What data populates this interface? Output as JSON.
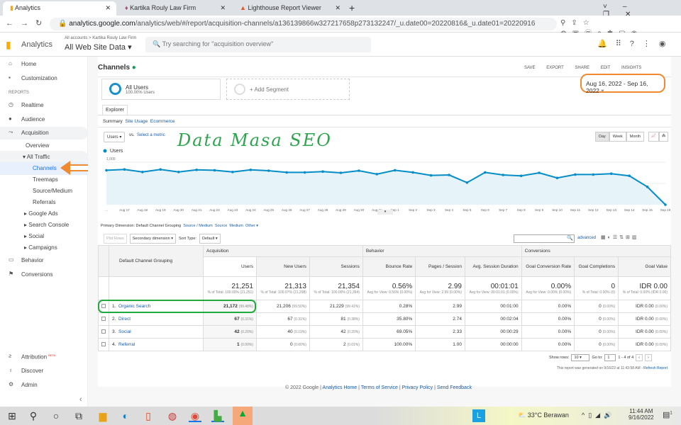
{
  "browser": {
    "tabs": [
      {
        "label": "Analytics",
        "active": true
      },
      {
        "label": "Kartika Rouly Law Firm"
      },
      {
        "label": "Lighthouse Report Viewer"
      }
    ],
    "url_domain": "analytics.google.com",
    "url_path": "/analytics/web/#/report/acquisition-channels/a136139866w327217658p273132247/_u.date00=20220816&_u.date01=20220916"
  },
  "ga": {
    "product": "Analytics",
    "breadcrumb": "All accounts > Kartika Rouly Law Firm",
    "property": "All Web Site Data",
    "search_placeholder": "Try searching for \"acquisition overview\"",
    "notif_count": "2"
  },
  "sidebar": {
    "items": [
      {
        "label": "Home",
        "icon": "home-icon"
      },
      {
        "label": "Customization",
        "icon": "dashboard-icon"
      }
    ],
    "reports_label": "REPORTS",
    "reports": [
      {
        "label": "Realtime",
        "icon": "clock-icon"
      },
      {
        "label": "Audience",
        "icon": "person-icon"
      },
      {
        "label": "Acquisition",
        "icon": "acquisition-icon"
      }
    ],
    "acq_sub": [
      "Overview",
      "All Traffic",
      "Channels",
      "Treemaps",
      "Source/Medium",
      "Referrals",
      "Google Ads",
      "Search Console",
      "Social",
      "Campaigns"
    ],
    "more": [
      {
        "label": "Behavior"
      },
      {
        "label": "Conversions"
      }
    ],
    "bottom": [
      {
        "label": "Attribution",
        "badge": "BETA"
      },
      {
        "label": "Discover"
      },
      {
        "label": "Admin"
      }
    ]
  },
  "report": {
    "title": "Channels",
    "actions": [
      "SAVE",
      "EXPORT",
      "SHARE",
      "EDIT",
      "INSIGHTS"
    ],
    "segment": {
      "name": "All Users",
      "sub": "100.00% Users",
      "add": "+ Add Segment"
    },
    "date_range": "Aug 16, 2022 - Sep 16, 2022",
    "explorer_tab": "Explorer",
    "subtabs": [
      "Summary",
      "Site Usage",
      "Ecommerce"
    ],
    "metric": "Users",
    "vs": "vs.",
    "select_metric": "Select a metric",
    "granularity": [
      "Day",
      "Week",
      "Month"
    ],
    "annotation": "Data Masa SEO",
    "primary_dim_label": "Primary Dimension:",
    "primary_dims": [
      "Default Channel Grouping",
      "Source / Medium",
      "Source",
      "Medium",
      "Other"
    ],
    "plot_rows": "Plot Rows",
    "secondary_dim": "Secondary dimension",
    "sort_type_label": "Sort Type:",
    "sort_type": "Default",
    "advanced": "advanced"
  },
  "chart_data": {
    "type": "area",
    "series": [
      {
        "name": "Users",
        "values": [
          810,
          830,
          770,
          830,
          770,
          820,
          810,
          770,
          820,
          800,
          760,
          760,
          780,
          750,
          800,
          720,
          810,
          760,
          690,
          700,
          520,
          760,
          700,
          680,
          750,
          630,
          710,
          710,
          730,
          680,
          420,
          0
        ]
      }
    ],
    "x": [
      "…",
      "Aug 17",
      "Aug 18",
      "Aug 19",
      "Aug 20",
      "Aug 21",
      "Aug 22",
      "Aug 23",
      "Aug 24",
      "Aug 25",
      "Aug 26",
      "Aug 27",
      "Aug 28",
      "Aug 29",
      "Aug 30",
      "Aug 31",
      "Sep 1",
      "Sep 2",
      "Sep 3",
      "Sep 4",
      "Sep 5",
      "Sep 6",
      "Sep 7",
      "Sep 8",
      "Sep 9",
      "Sep 10",
      "Sep 11",
      "Sep 12",
      "Sep 13",
      "Sep 14",
      "Sep 15",
      "Sep 16"
    ],
    "yticks": [
      "1,000",
      "500"
    ],
    "ylim": [
      0,
      1000
    ],
    "grid": true,
    "color": "#058dc7",
    "fill": "#e6f4fa"
  },
  "table": {
    "dim_header": "Default Channel Grouping",
    "groups": [
      "Acquisition",
      "Behavior",
      "Conversions"
    ],
    "columns": [
      "Users",
      "New Users",
      "Sessions",
      "Bounce Rate",
      "Pages / Session",
      "Avg. Session Duration",
      "Goal Conversion Rate",
      "Goal Completions",
      "Goal Value"
    ],
    "totals": [
      [
        "21,251",
        "% of Total: 100.00% (21,251)"
      ],
      [
        "21,313",
        "% of Total: 100.07% (21,298)"
      ],
      [
        "21,354",
        "% of Total: 100.00% (21,354)"
      ],
      [
        "0.56%",
        "Avg for View: 0.56% (0.00%)"
      ],
      [
        "2.99",
        "Avg for View: 2.99 (0.00%)"
      ],
      [
        "00:01:01",
        "Avg for View: 00:01:01 (0.00%)"
      ],
      [
        "0.00%",
        "Avg for View: 0.00% (0.00%)"
      ],
      [
        "0",
        "% of Total: 0.00% (0)"
      ],
      [
        "IDR 0.00",
        "% of Total: 0.00% (IDR 0.00)"
      ]
    ],
    "rows": [
      {
        "idx": "1.",
        "name": "Organic Search",
        "cells": [
          [
            "21,172",
            "(99.48%)"
          ],
          [
            "21,206",
            "(99.50%)"
          ],
          [
            "21,229",
            "(99.41%)"
          ],
          [
            "0.28%",
            ""
          ],
          [
            "2.99",
            ""
          ],
          [
            "00:01:00",
            ""
          ],
          [
            "0.00%",
            ""
          ],
          [
            "0",
            "(0.00%)"
          ],
          [
            "IDR 0.00",
            "(0.00%)"
          ]
        ]
      },
      {
        "idx": "2.",
        "name": "Direct",
        "cells": [
          [
            "67",
            "(0.31%)"
          ],
          [
            "67",
            "(0.31%)"
          ],
          [
            "81",
            "(0.38%)"
          ],
          [
            "35.80%",
            ""
          ],
          [
            "2.74",
            ""
          ],
          [
            "00:02:04",
            ""
          ],
          [
            "0.00%",
            ""
          ],
          [
            "0",
            "(0.00%)"
          ],
          [
            "IDR 0.00",
            "(0.00%)"
          ]
        ]
      },
      {
        "idx": "3.",
        "name": "Social",
        "cells": [
          [
            "42",
            "(0.20%)"
          ],
          [
            "40",
            "(0.19%)"
          ],
          [
            "42",
            "(0.20%)"
          ],
          [
            "69.05%",
            ""
          ],
          [
            "2.33",
            ""
          ],
          [
            "00:00:29",
            ""
          ],
          [
            "0.00%",
            ""
          ],
          [
            "0",
            "(0.00%)"
          ],
          [
            "IDR 0.00",
            "(0.00%)"
          ]
        ]
      },
      {
        "idx": "4.",
        "name": "Referral",
        "cells": [
          [
            "1",
            "(0.00%)"
          ],
          [
            "0",
            "(0.00%)"
          ],
          [
            "2",
            "(0.01%)"
          ],
          [
            "100.00%",
            ""
          ],
          [
            "1.00",
            ""
          ],
          [
            "00:00:00",
            ""
          ],
          [
            "0.00%",
            ""
          ],
          [
            "0",
            "(0.00%)"
          ],
          [
            "IDR 0.00",
            "(0.00%)"
          ]
        ]
      }
    ],
    "show_rows_label": "Show rows:",
    "show_rows": "10",
    "goto_label": "Go to:",
    "goto": "1",
    "range": "1 - 4 of 4",
    "generated": "This report was generated on 9/16/22 at 11:43:58 AM - ",
    "refresh": "Refresh Report"
  },
  "footer": {
    "copyright": "© 2022 Google |",
    "links": [
      "Analytics Home",
      "Terms of Service",
      "Privacy Policy",
      "Send Feedback"
    ]
  },
  "taskbar": {
    "weather": "33°C  Berawan",
    "time": "11:44 AM",
    "date": "9/16/2022",
    "notif": "1"
  }
}
